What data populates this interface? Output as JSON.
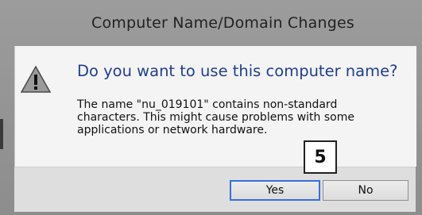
{
  "window": {
    "title": "Computer Name/Domain Changes"
  },
  "dialog": {
    "heading": "Do you want to use this computer name?",
    "message": "The name \"nu_019101\" contains non-standard characters. This might cause problems with some applications or network hardware.",
    "icon": "warning-icon"
  },
  "buttons": {
    "yes_label": "Yes",
    "no_label": "No"
  },
  "annotation": {
    "step_number": "5"
  },
  "colors": {
    "heading": "#1f3f8f",
    "focus_border": "#3a6fd8"
  }
}
